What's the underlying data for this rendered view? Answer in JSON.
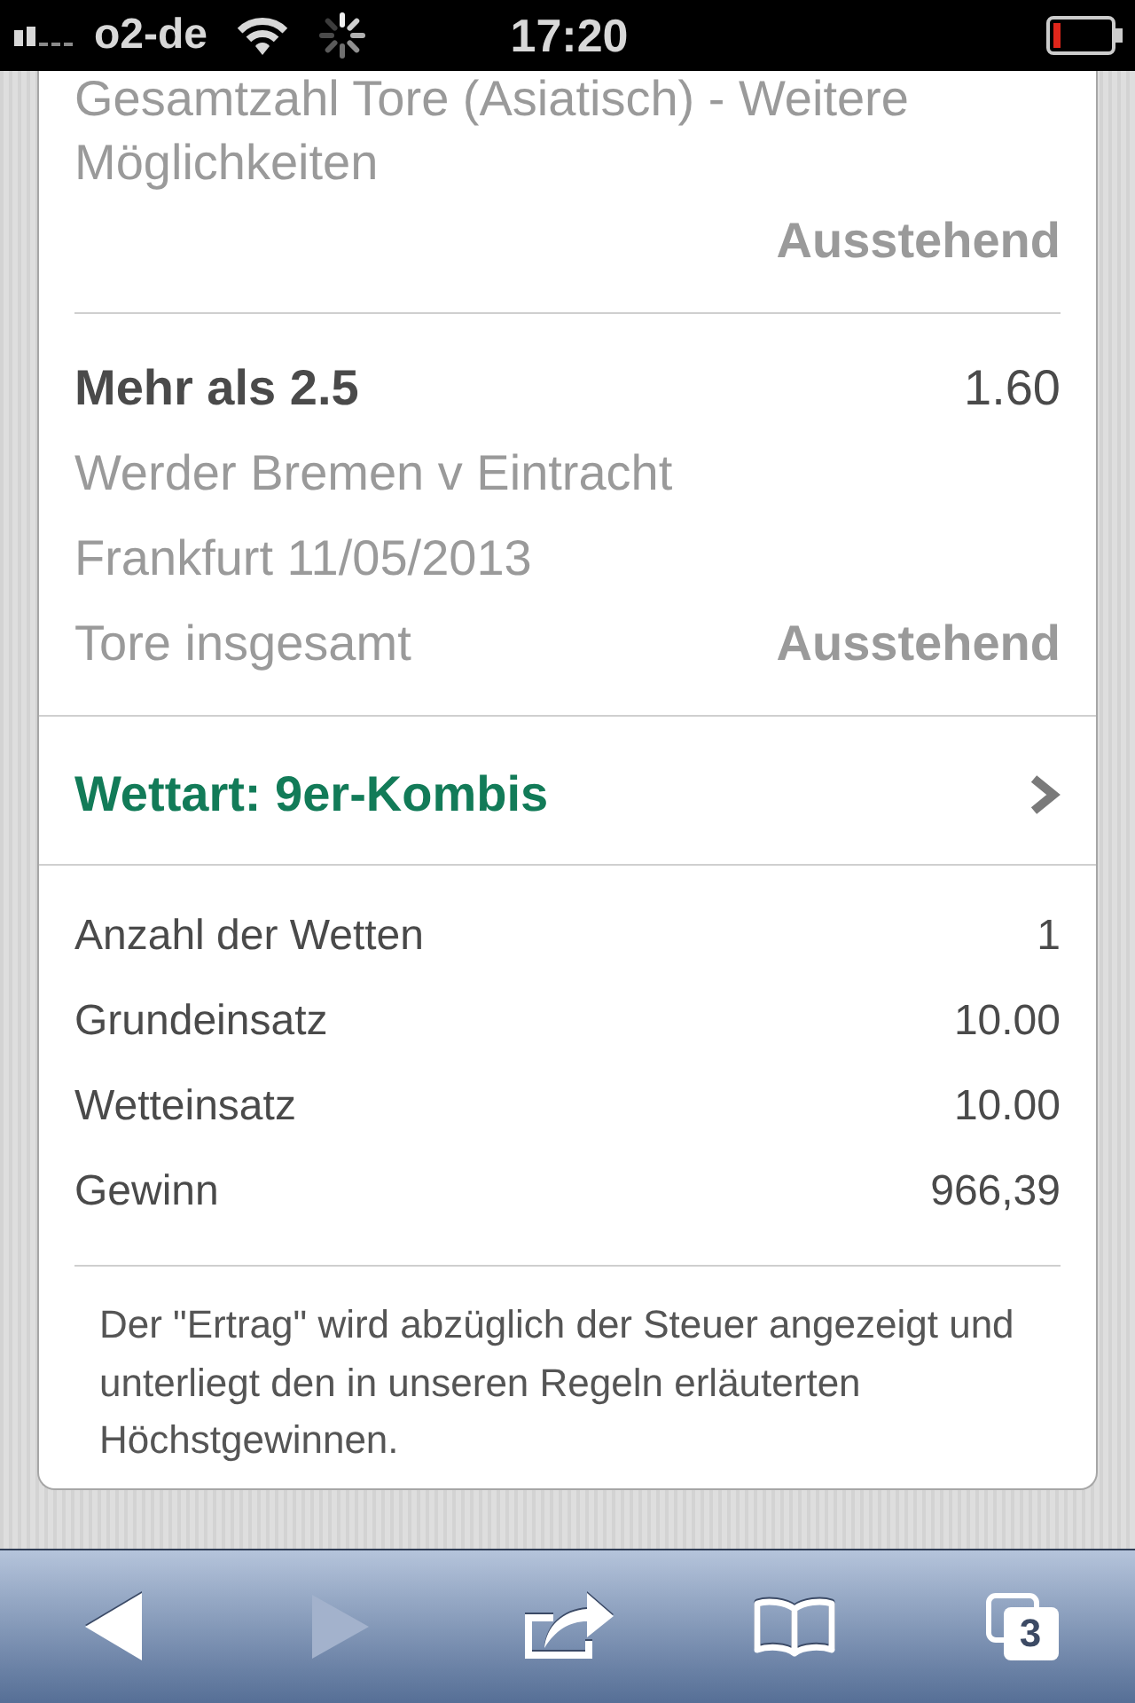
{
  "status_bar": {
    "carrier": "o2-de",
    "time": "17:20"
  },
  "selections": [
    {
      "kind": "partial",
      "market_lines": [
        "Gesamtzahl Tore (Asiatisch) - Weitere",
        "Möglichkeiten"
      ],
      "status": "Ausstehend"
    },
    {
      "kind": "full",
      "pick": "Mehr als 2.5",
      "odds": "1.60",
      "event": "Werder Bremen v Eintracht Frankfurt 11/05/2013",
      "market": "Tore insgesamt",
      "status": "Ausstehend"
    }
  ],
  "bet_type": "Wettart: 9er-Kombis",
  "summary": [
    {
      "label": "Anzahl der Wetten",
      "value": "1"
    },
    {
      "label": "Grundeinsatz",
      "value": "10.00"
    },
    {
      "label": "Wetteinsatz",
      "value": "10.00"
    },
    {
      "label": "Gewinn",
      "value": "966,39"
    }
  ],
  "note": "Der \"Ertrag\" wird abzüglich der Steuer angezeigt und unterliegt den in unseren Regeln erläuterten Höchstgewinnen.",
  "toolbar": [
    {
      "kind": "back",
      "disabled": false
    },
    {
      "kind": "forward",
      "disabled": true
    },
    {
      "kind": "share",
      "disabled": false
    },
    {
      "kind": "bookmarks",
      "disabled": false
    },
    {
      "kind": "tabs",
      "disabled": false,
      "count": "3"
    }
  ]
}
